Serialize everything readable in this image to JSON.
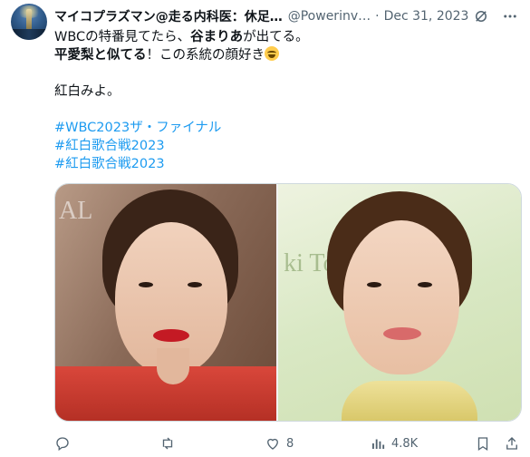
{
  "author": {
    "display_name": "マイコプラズマン@走る内科医：休足…",
    "handle": "@Powerinv…",
    "date": "Dec 31, 2023"
  },
  "tweet_lines": [
    {
      "parts": [
        {
          "text": "WBCの特番見てたら、",
          "bold": false
        },
        {
          "text": "谷まりあ",
          "bold": true
        },
        {
          "text": "が出てる。",
          "bold": false
        }
      ]
    },
    {
      "parts": [
        {
          "text": "平愛梨と似てる",
          "bold": true
        },
        {
          "text": "！この系統の顔好き",
          "bold": false
        }
      ]
    },
    {
      "parts": []
    },
    {
      "parts": [
        {
          "text": "紅白みよ。",
          "bold": false
        }
      ]
    },
    {
      "parts": []
    }
  ],
  "hashtags": [
    "#WBC2023ザ・ファイナル",
    "#紅白歌合戦2023",
    "#紅白歌合戦2023"
  ],
  "emoji_name": "face-with-tears-of-joy",
  "media": {
    "left_watermark": "AL",
    "right_watermark": "ki To"
  },
  "actions": {
    "reply_count": "",
    "retweet_count": "",
    "like_count": "8",
    "views_count": "4.8K"
  },
  "colors": {
    "text": "#0f1419",
    "secondary": "#536471",
    "link": "#1d9bf0",
    "border": "#cfd9de"
  }
}
